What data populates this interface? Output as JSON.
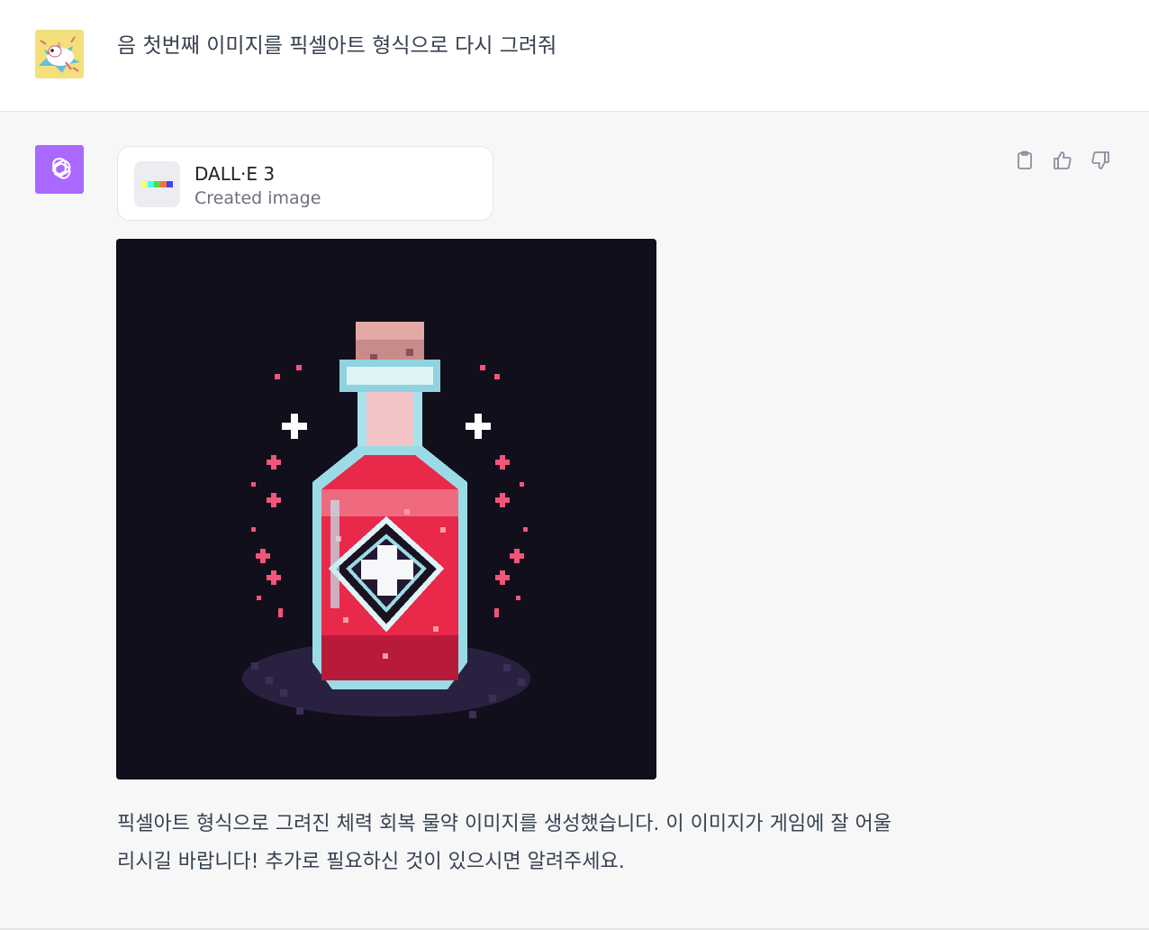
{
  "user_message": {
    "text": "음 첫번째 이미지를 픽셀아트 형식으로 다시 그려줘"
  },
  "assistant_message": {
    "tool": {
      "name": "DALL·E 3",
      "status": "Created image"
    },
    "lines": [
      "픽셀아트 형식으로 그려진 체력 회복 물약 이미지를 생성했습니다. 이 이미지가 게임에 잘 어울",
      "리시길 바랍니다! 추가로 필요하신 것이 있으시면 알려주세요."
    ]
  },
  "actions": [
    "copy-icon",
    "thumbs-up-icon",
    "thumbs-down-icon"
  ],
  "colors": {
    "assistant_bg": "#f7f7f8",
    "gpt_avatar": "#ab68ff",
    "image_bg": "#120f1c",
    "potion_red": "#e8294a"
  }
}
